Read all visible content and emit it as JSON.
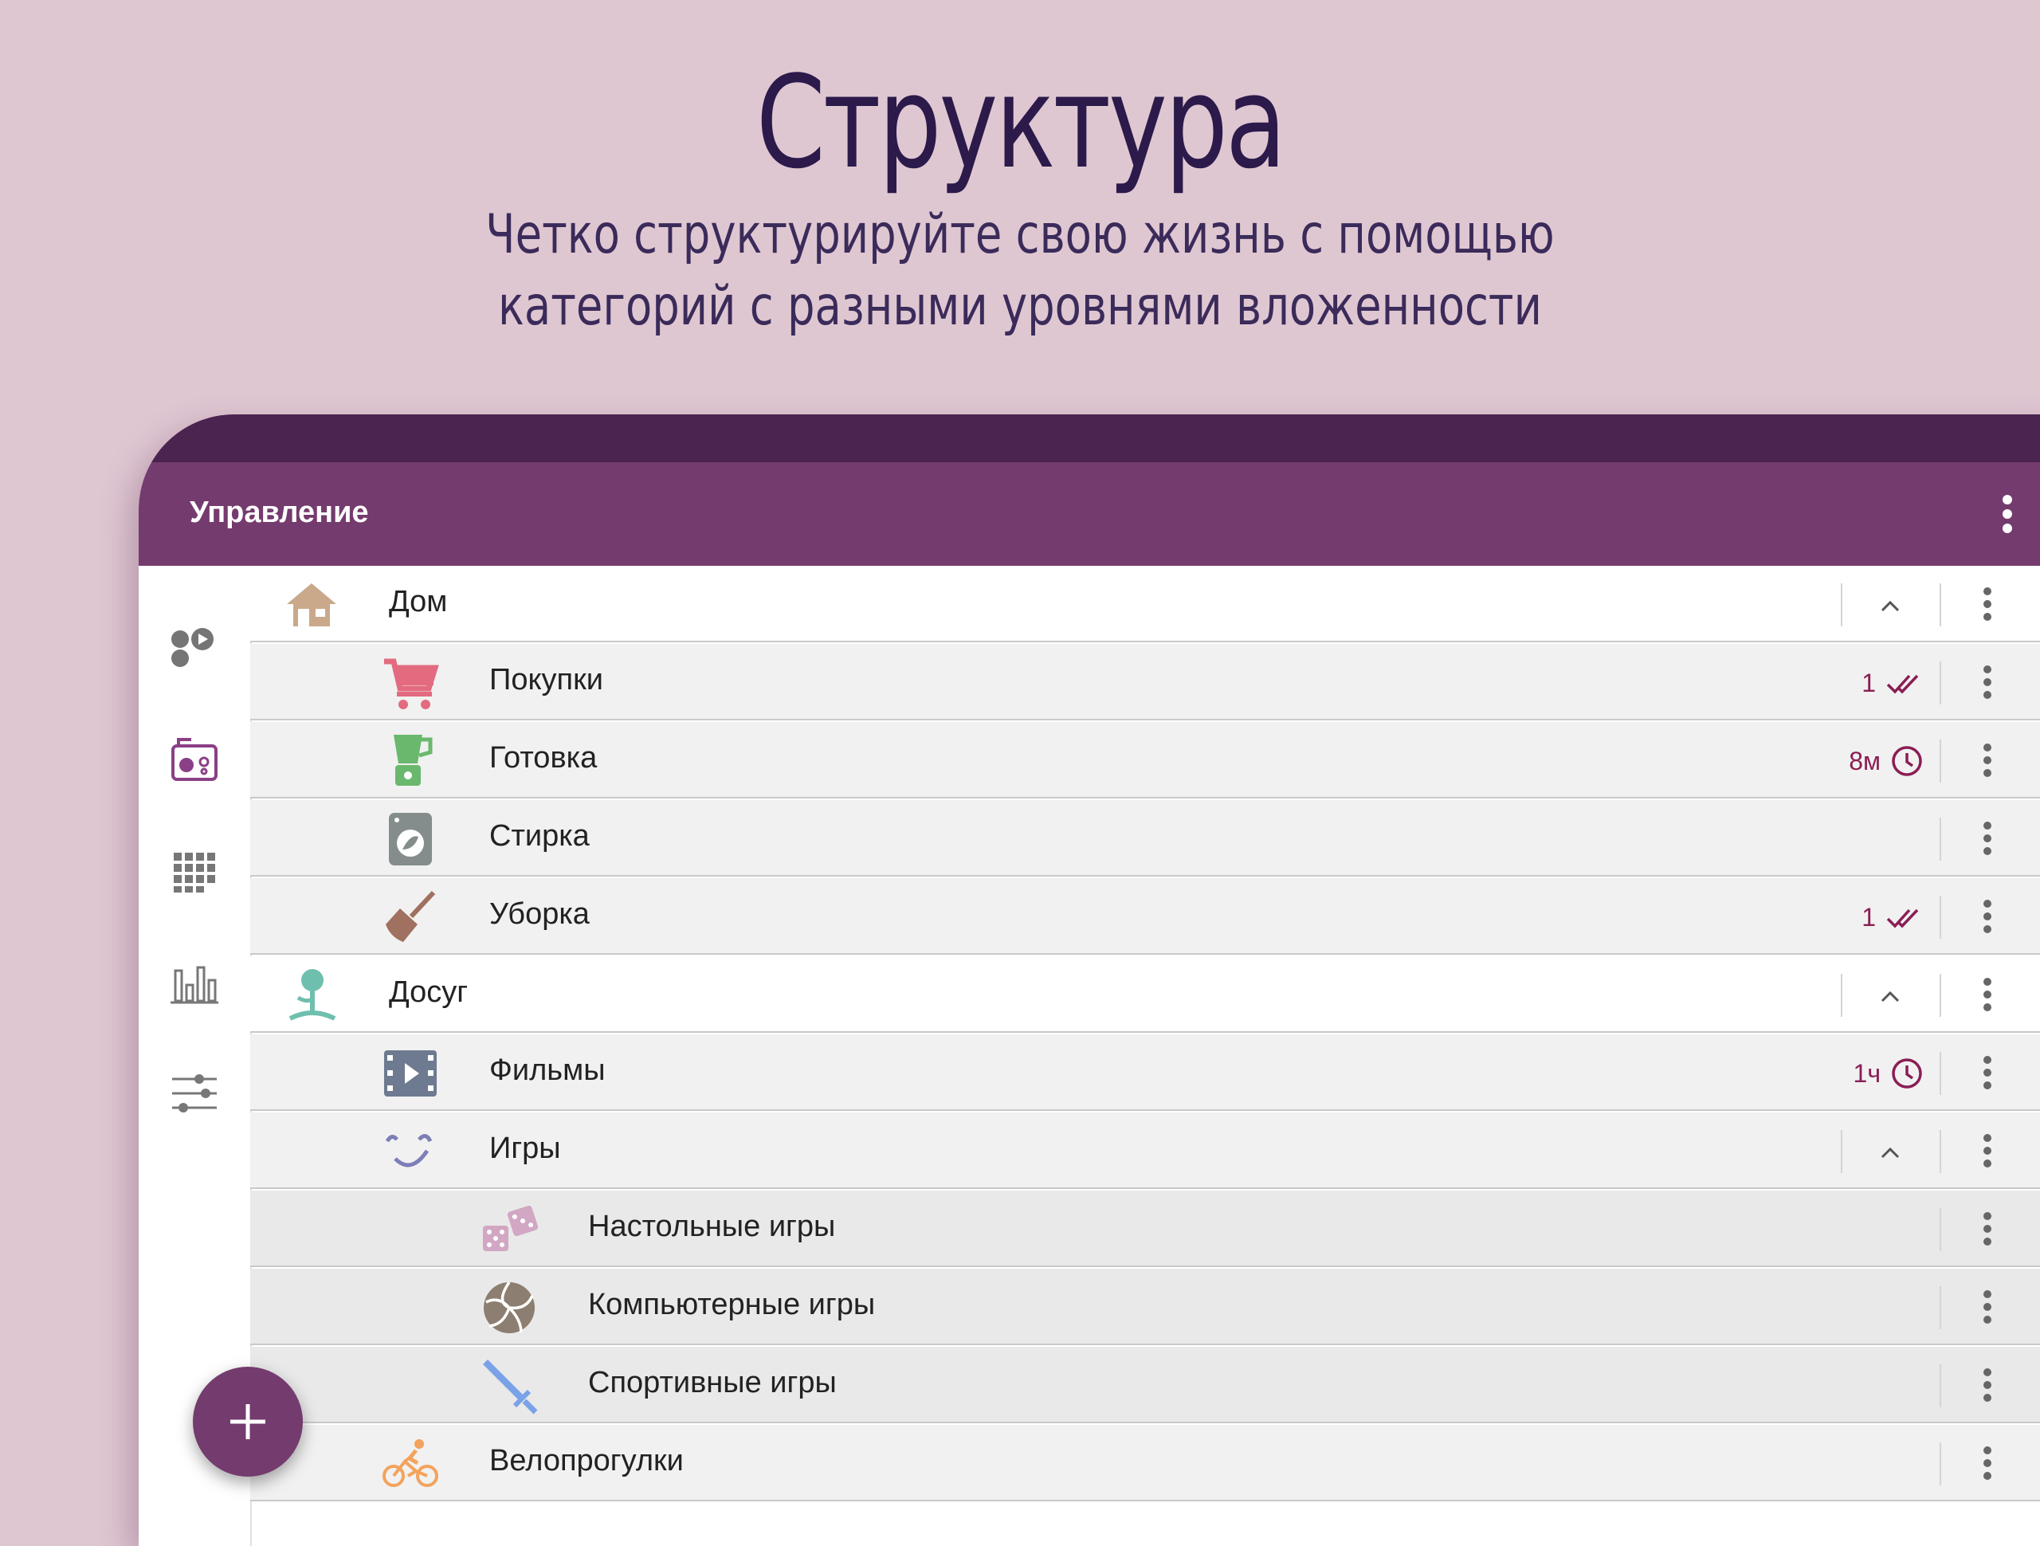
{
  "headline": "Структура",
  "subheadline_line1": "Четко структурируйте свою жизнь с помощью",
  "subheadline_line2": "категорий с разными уровнями вложенности",
  "appbar": {
    "title": "Управление",
    "menu_icon": "more-vert-icon"
  },
  "colors": {
    "accent": "#743b6e",
    "statusbar": "#4b2450",
    "background": "#dfc7d2",
    "stat": "#8a1e54"
  },
  "rail": [
    {
      "icon": "activities-icon"
    },
    {
      "icon": "radio-icon"
    },
    {
      "icon": "grid-icon"
    },
    {
      "icon": "bar-chart-icon"
    },
    {
      "icon": "sliders-icon"
    }
  ],
  "categories": [
    {
      "label": "Дом",
      "icon": "house-icon",
      "level": 0,
      "expandable": true
    },
    {
      "label": "Покупки",
      "icon": "cart-icon",
      "level": 1,
      "stat_value": "1",
      "stat_icon": "done-all-icon"
    },
    {
      "label": "Готовка",
      "icon": "blender-icon",
      "level": 1,
      "stat_value": "8м",
      "stat_icon": "clock-icon"
    },
    {
      "label": "Стирка",
      "icon": "washing-machine-icon",
      "level": 1
    },
    {
      "label": "Уборка",
      "icon": "broom-icon",
      "level": 1,
      "stat_value": "1",
      "stat_icon": "done-all-icon"
    },
    {
      "label": "Досуг",
      "icon": "tree-icon",
      "level": 0,
      "expandable": true
    },
    {
      "label": "Фильмы",
      "icon": "film-icon",
      "level": 1,
      "stat_value": "1ч",
      "stat_icon": "clock-icon"
    },
    {
      "label": "Игры",
      "icon": "smile-icon",
      "level": 1,
      "expandable": true
    },
    {
      "label": "Настольные игры",
      "icon": "dice-icon",
      "level": 2
    },
    {
      "label": "Компьютерные игры",
      "icon": "volleyball-icon",
      "level": 2
    },
    {
      "label": "Спортивные игры",
      "icon": "sword-icon",
      "level": 2
    },
    {
      "label": "Велопрогулки",
      "icon": "bicycle-icon",
      "level": 1
    }
  ],
  "fab": {
    "icon": "plus-icon"
  }
}
